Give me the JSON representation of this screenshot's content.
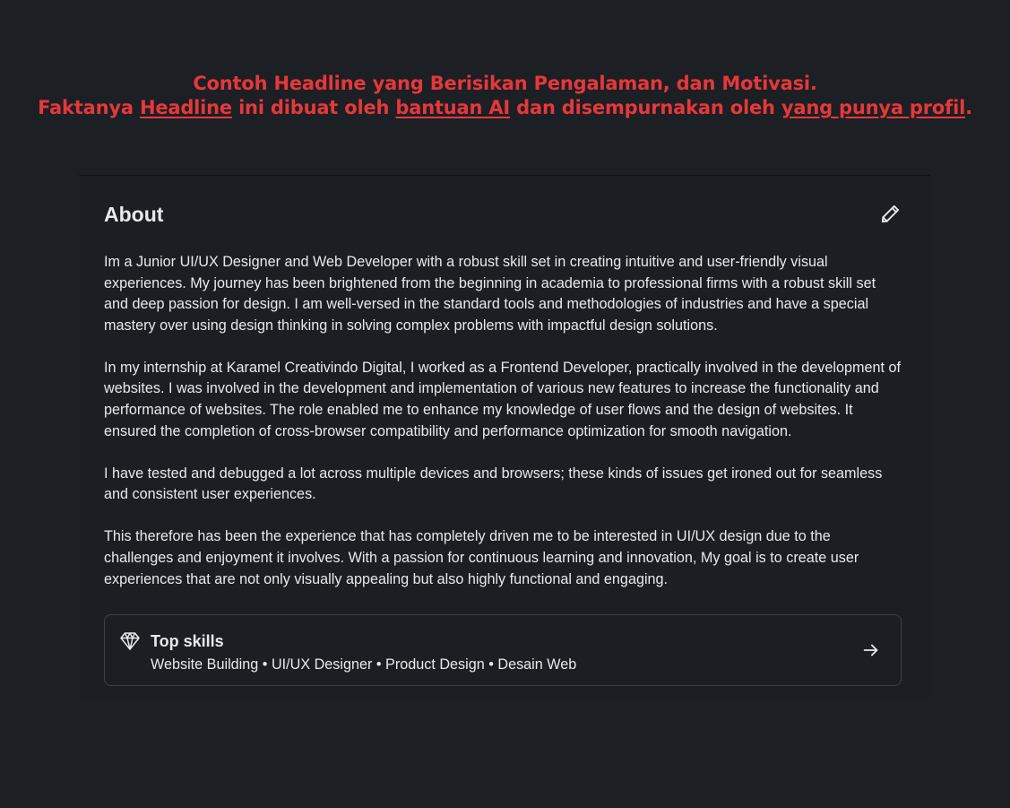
{
  "caption": {
    "line1": "Contoh Headline yang Berisikan Pengalaman, dan Motivasi.",
    "line2_a": "Faktanya ",
    "line2_b": "Headline",
    "line2_c": " ini dibuat oleh ",
    "line2_d": "bantuan AI",
    "line2_e": " dan disempurnakan oleh ",
    "line2_f": "yang punya profil",
    "line2_g": "."
  },
  "about": {
    "title": "About",
    "edit_icon": "pencil-icon",
    "paragraphs": [
      "Im a Junior UI/UX Designer and Web Developer with a robust skill set in creating intuitive and user-friendly visual experiences. My journey has been brightened from the beginning in academia to professional firms with a robust skill set and deep passion for design. I am well-versed in the standard tools and methodologies of industries and have a special mastery over using design thinking in solving complex problems with impactful design solutions.",
      "In my internship at Karamel Creativindo Digital, I worked as a Frontend Developer, practically involved in the development of websites. I was involved in the development and implementation of various new features to increase the functionality and performance of websites. The role enabled me to enhance my knowledge of user flows and the design of websites. It ensured the completion of cross-browser compatibility and performance optimization for smooth navigation.",
      "I have tested and debugged a lot across multiple devices and browsers; these kinds of issues get ironed out for seamless and consistent user experiences.",
      "This therefore has been the experience that has completely driven me to be interested in UI/UX design due to the challenges and enjoyment it involves. With a passion for continuous learning and innovation, My goal is to create user experiences that are not only visually appealing but also highly functional and engaging."
    ]
  },
  "top_skills": {
    "icon": "diamond-icon",
    "title": "Top skills",
    "list": "Website Building • UI/UX Designer • Product Design • Desain Web",
    "arrow_icon": "arrow-right-icon"
  },
  "colors": {
    "background": "#1c1f24",
    "card": "#1b1f23",
    "caption_red": "#e5383b",
    "text": "#e8e9ea",
    "border": "#3b4147"
  }
}
